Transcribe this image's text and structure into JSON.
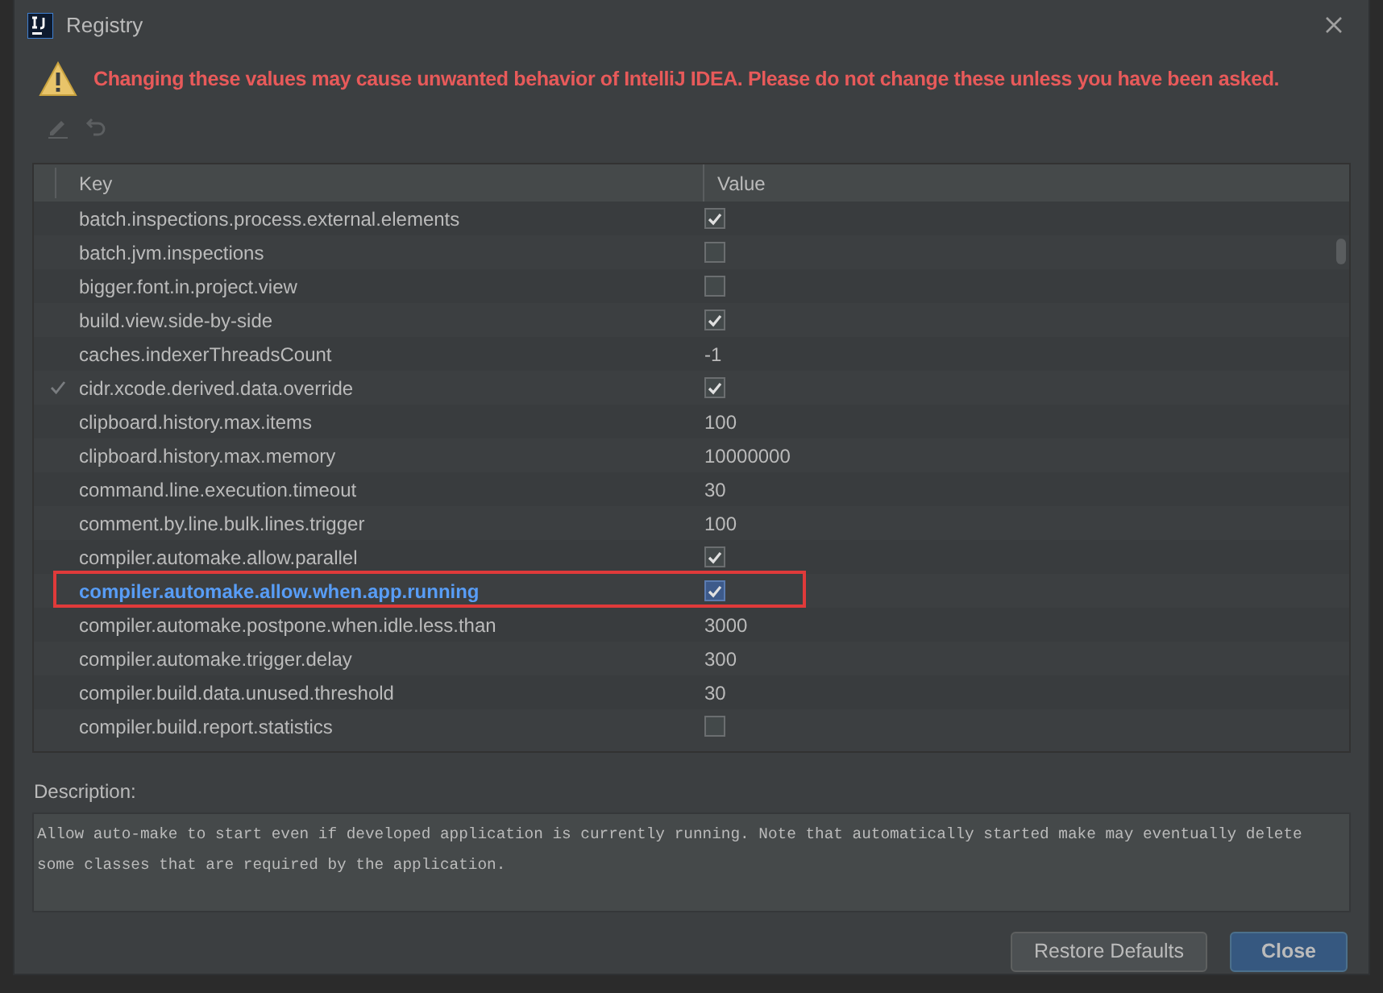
{
  "window": {
    "title": "Registry"
  },
  "warning": "Changing these values may cause unwanted behavior of IntelliJ IDEA. Please do not change these unless you have been asked.",
  "toolbar": [
    {
      "kind": "edit",
      "disabled": true
    },
    {
      "kind": "revert",
      "disabled": true
    }
  ],
  "table": {
    "columns": [
      "Key",
      "Value"
    ],
    "rows": [
      {
        "key": "batch.inspections.process.external.elements",
        "kind": "checkbox",
        "checked": true,
        "modified": false,
        "selected": false,
        "outlined": false
      },
      {
        "key": "batch.jvm.inspections",
        "kind": "checkbox",
        "checked": false,
        "modified": false,
        "selected": false,
        "outlined": false
      },
      {
        "key": "bigger.font.in.project.view",
        "kind": "checkbox",
        "checked": false,
        "modified": false,
        "selected": false,
        "outlined": false
      },
      {
        "key": "build.view.side-by-side",
        "kind": "checkbox",
        "checked": true,
        "modified": false,
        "selected": false,
        "outlined": false
      },
      {
        "key": "caches.indexerThreadsCount",
        "kind": "text",
        "value": "-1",
        "modified": false,
        "selected": false,
        "outlined": false
      },
      {
        "key": "cidr.xcode.derived.data.override",
        "kind": "checkbox",
        "checked": true,
        "modified": true,
        "selected": false,
        "outlined": false
      },
      {
        "key": "clipboard.history.max.items",
        "kind": "text",
        "value": "100",
        "modified": false,
        "selected": false,
        "outlined": false
      },
      {
        "key": "clipboard.history.max.memory",
        "kind": "text",
        "value": "10000000",
        "modified": false,
        "selected": false,
        "outlined": false
      },
      {
        "key": "command.line.execution.timeout",
        "kind": "text",
        "value": "30",
        "modified": false,
        "selected": false,
        "outlined": false
      },
      {
        "key": "comment.by.line.bulk.lines.trigger",
        "kind": "text",
        "value": "100",
        "modified": false,
        "selected": false,
        "outlined": false
      },
      {
        "key": "compiler.automake.allow.parallel",
        "kind": "checkbox",
        "checked": true,
        "modified": false,
        "selected": false,
        "outlined": false
      },
      {
        "key": "compiler.automake.allow.when.app.running",
        "kind": "checkbox",
        "checked": true,
        "modified": false,
        "selected": true,
        "outlined": true
      },
      {
        "key": "compiler.automake.postpone.when.idle.less.than",
        "kind": "text",
        "value": "3000",
        "modified": false,
        "selected": false,
        "outlined": false
      },
      {
        "key": "compiler.automake.trigger.delay",
        "kind": "text",
        "value": "300",
        "modified": false,
        "selected": false,
        "outlined": false
      },
      {
        "key": "compiler.build.data.unused.threshold",
        "kind": "text",
        "value": "30",
        "modified": false,
        "selected": false,
        "outlined": false
      },
      {
        "key": "compiler.build.report.statistics",
        "kind": "checkbox",
        "checked": false,
        "modified": false,
        "selected": false,
        "outlined": false
      }
    ]
  },
  "description": {
    "label": "Description:",
    "text": "Allow auto-make to start even if developed application is currently running. Note that automatically started make may eventually delete some classes that are required by the application."
  },
  "buttons": [
    {
      "label": "Restore Defaults",
      "primary": false
    },
    {
      "label": "Close",
      "primary": true
    }
  ]
}
